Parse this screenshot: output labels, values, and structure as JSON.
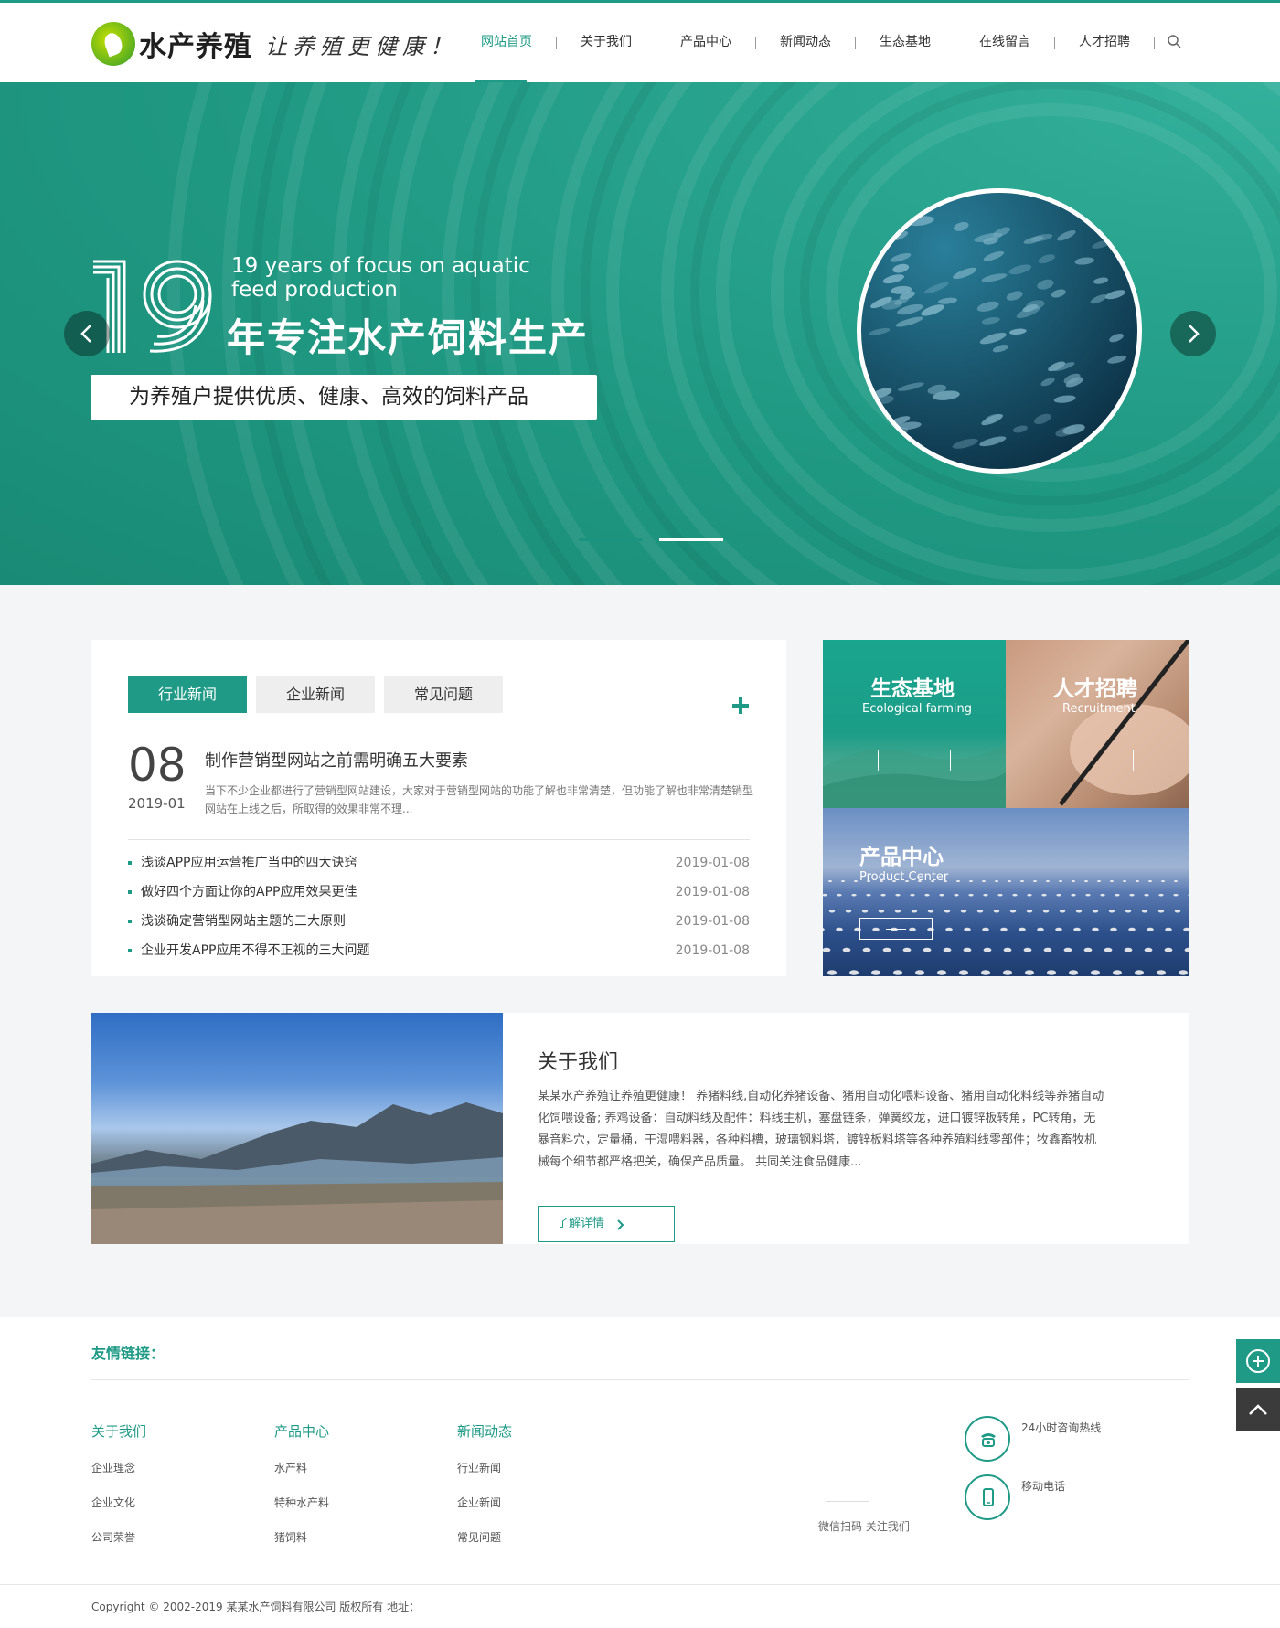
{
  "header": {
    "logo_name": "水产养殖",
    "logo_slogan": "让养殖更健康！",
    "nav": [
      {
        "label": "网站首页",
        "active": true
      },
      {
        "label": "关于我们"
      },
      {
        "label": "产品中心"
      },
      {
        "label": "新闻动态"
      },
      {
        "label": "生态基地"
      },
      {
        "label": "在线留言"
      },
      {
        "label": "人才招聘"
      }
    ],
    "search_icon": "search-icon"
  },
  "banner": {
    "big_number": "19",
    "en_line1": "19 years of focus on aquatic",
    "en_line2": "feed production",
    "cn_title": "年专注水产饲料生产",
    "subtitle": "为养殖户提供优质、健康、高效的饲料产品",
    "slide_count": 2,
    "active_slide": 2
  },
  "news": {
    "tabs": [
      "行业新闻",
      "企业新闻",
      "常见问题"
    ],
    "active_tab": 0,
    "featured": {
      "day": "08",
      "year_month": "2019-01",
      "title": "制作营销型网站之前需明确五大要素",
      "desc": "当下不少企业都进行了营销型网站建设，大家对于营销型网站的功能了解也非常清楚，但功能了解也非常清楚销型网站在上线之后，所取得的效果非常不理..."
    },
    "items": [
      {
        "title": "浅谈APP应用运营推广当中的四大诀窍",
        "date": "2019-01-08"
      },
      {
        "title": "做好四个方面让你的APP应用效果更佳",
        "date": "2019-01-08"
      },
      {
        "title": "浅谈确定营销型网站主题的三大原则",
        "date": "2019-01-08"
      },
      {
        "title": "企业开发APP应用不得不正视的三大问题",
        "date": "2019-01-08"
      }
    ]
  },
  "tiles": {
    "eco": {
      "title": "生态基地",
      "sub": "Ecological farming"
    },
    "recruit": {
      "title": "人才招聘",
      "sub": "Recruitment"
    },
    "product": {
      "title": "产品中心",
      "sub": "Product Center"
    }
  },
  "about": {
    "title": "关于我们",
    "text": "某某水产养殖让养殖更健康！ 养猪料线,自动化养猪设备、猪用自动化喂料设备、猪用自动化料线等养猪自动化饲喂设备; 养鸡设备：自动料线及配件：料线主机，塞盘链条，弹簧绞龙，进口镀锌板转角，PC转角，无暴音料穴，定量桶，干湿喂料器，各种料槽，玻璃钢料塔，镀锌板料塔等各种养殖料线零部件；牧鑫畜牧机械每个细节都严格把关，确保产品质量。 共同关注食品健康...",
    "button": "了解详情"
  },
  "footer": {
    "friend_links_title": "友情链接：",
    "columns": [
      {
        "title": "关于我们",
        "links": [
          "企业理念",
          "企业文化",
          "公司荣誉"
        ]
      },
      {
        "title": "产品中心",
        "links": [
          "水产料",
          "特种水产料",
          "猪饲料"
        ]
      },
      {
        "title": "新闻动态",
        "links": [
          "行业新闻",
          "企业新闻",
          "常见问题"
        ]
      }
    ],
    "qr_caption": "微信扫码 关注我们",
    "hotline_label": "24小时咨询热线",
    "mobile_label": "移动电话",
    "copyright": "Copyright © 2002-2019 某某水产饲料有限公司 版权所有    地址："
  },
  "colors": {
    "accent": "#1e9a86",
    "banner_bg": "#22a08a"
  }
}
